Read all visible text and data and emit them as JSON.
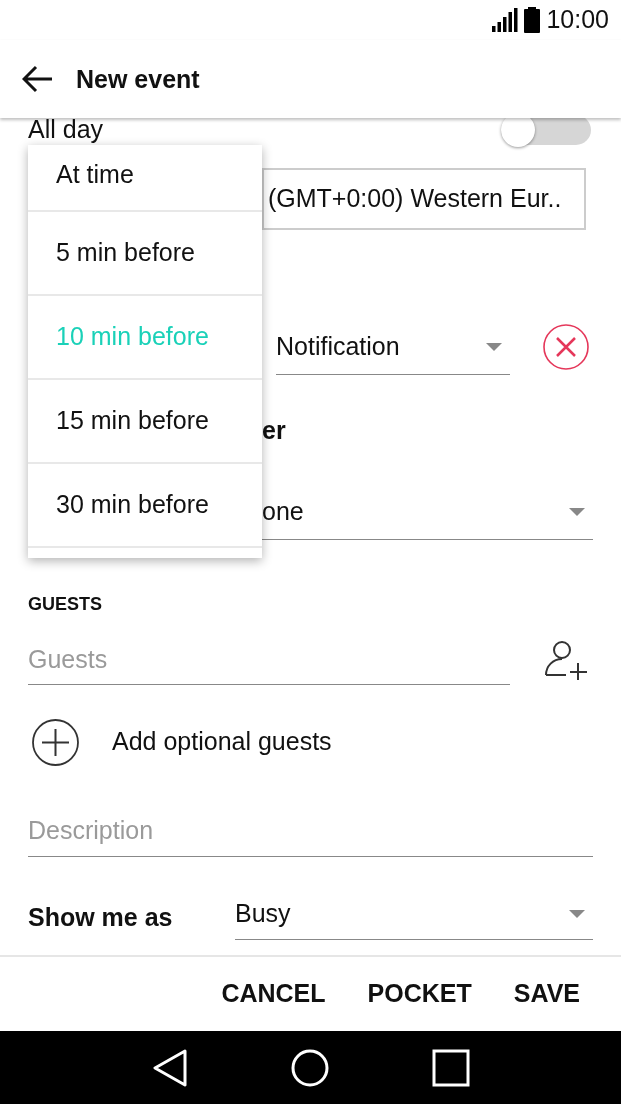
{
  "status_bar": {
    "time": "10:00"
  },
  "app_bar": {
    "title": "New event"
  },
  "all_day": {
    "label": "All day",
    "on": false
  },
  "timezone": {
    "value": "(GMT+0:00) Western Eur.."
  },
  "reminder": {
    "type": "Notification"
  },
  "reminder_menu": [
    {
      "label": "At time",
      "selected": false
    },
    {
      "label": "5 min before",
      "selected": false
    },
    {
      "label": "10 min before",
      "selected": true
    },
    {
      "label": "15 min before",
      "selected": false
    },
    {
      "label": "30 min before",
      "selected": false
    }
  ],
  "partial_label": "er",
  "partial_select": "one",
  "guests": {
    "heading": "GUESTS",
    "placeholder": "Guests",
    "add_optional": "Add optional guests"
  },
  "description": {
    "placeholder": "Description"
  },
  "show_me_as": {
    "label": "Show me as",
    "value": "Busy"
  },
  "buttons": [
    "CANCEL",
    "POCKET",
    "SAVE"
  ]
}
